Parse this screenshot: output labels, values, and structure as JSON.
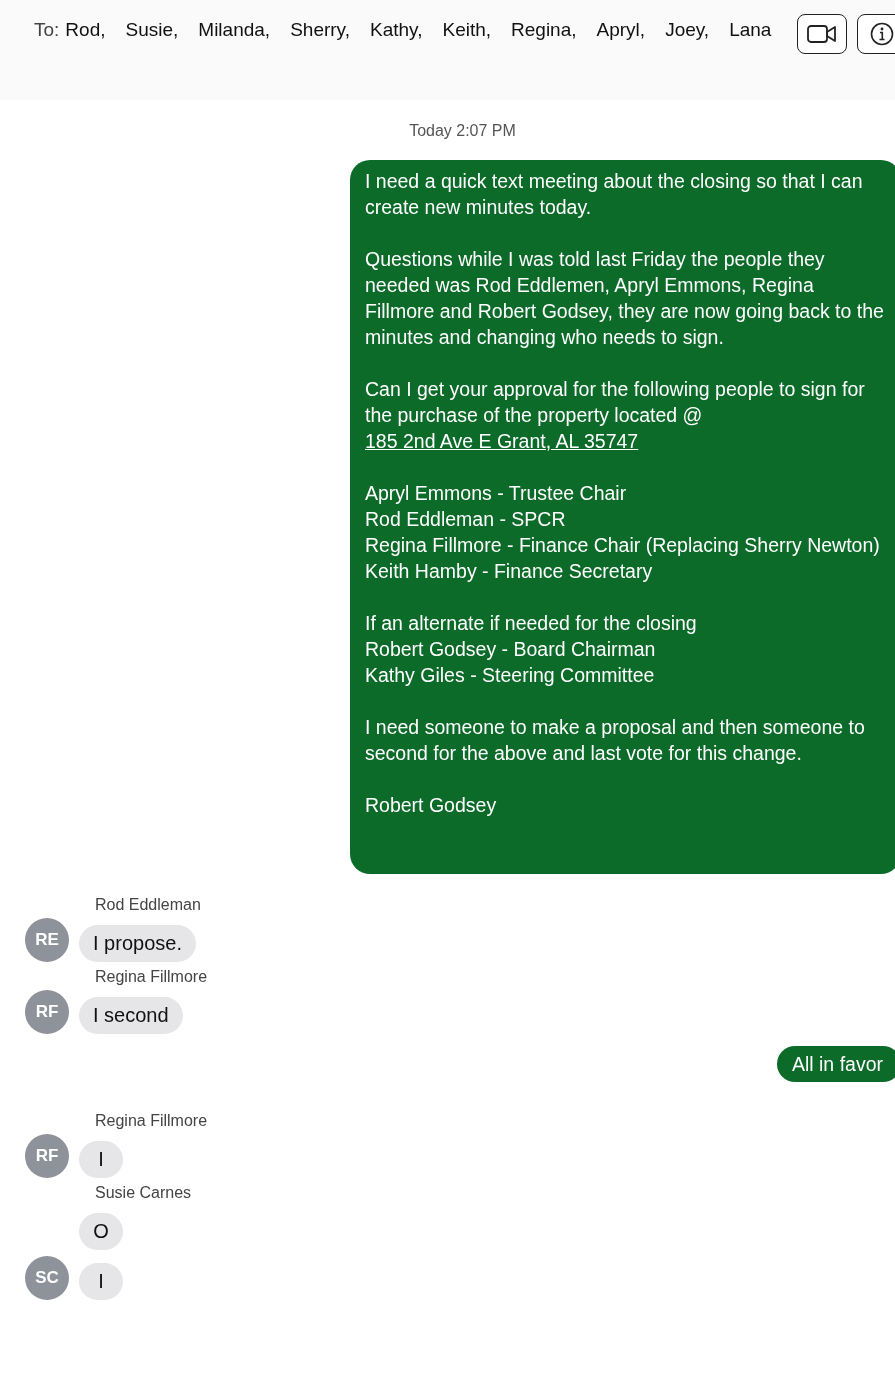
{
  "header": {
    "to_label": "To:",
    "recipients": [
      "Rod,",
      "Susie,",
      "Milanda,",
      "Sherry,",
      "Kathy,",
      "Keith,",
      "Regina,",
      "Apryl,",
      "Joey,",
      "Lana"
    ]
  },
  "timestamp": "Today 2:07 PM",
  "messages": [
    {
      "kind": "outgoing",
      "paragraphs": [
        {
          "text": "I need a quick text meeting about the closing so that I can create new minutes today."
        },
        {
          "text": "Questions while I was told last Friday the people they needed was Rod Eddlemen, Apryl Emmons, Regina Fillmore and Robert Godsey, they are now going back to the minutes and changing who needs to sign."
        },
        {
          "text": "Can I get your approval for the following people to sign for the purchase of the property located @ ",
          "link": "185 2nd Ave E Grant, AL 35747"
        },
        {
          "text": "Apryl Emmons - Trustee Chair\nRod Eddleman - SPCR\nRegina Fillmore - Finance Chair (Replacing Sherry Newton)\nKeith Hamby - Finance Secretary"
        },
        {
          "text": "If an alternate if needed for the closing\nRobert Godsey - Board Chairman\nKathy Giles - Steering Committee"
        },
        {
          "text": "I need someone to make a proposal and then someone to second for the above and last vote for this change."
        },
        {
          "text": "Robert Godsey"
        }
      ]
    },
    {
      "kind": "incoming",
      "sender": "Rod Eddleman",
      "avatar": "RE",
      "text": "I propose."
    },
    {
      "kind": "incoming",
      "sender": "Regina Fillmore",
      "avatar": "RF",
      "text": "I second"
    },
    {
      "kind": "outgoing",
      "paragraphs": [
        {
          "text": "All in favor"
        }
      ]
    },
    {
      "kind": "incoming",
      "sender": "Regina Fillmore",
      "avatar": "RF",
      "text": "I"
    },
    {
      "kind": "incoming",
      "sender": "Susie Carnes",
      "text": "O"
    },
    {
      "kind": "incoming",
      "avatar": "SC",
      "text": "I"
    }
  ]
}
